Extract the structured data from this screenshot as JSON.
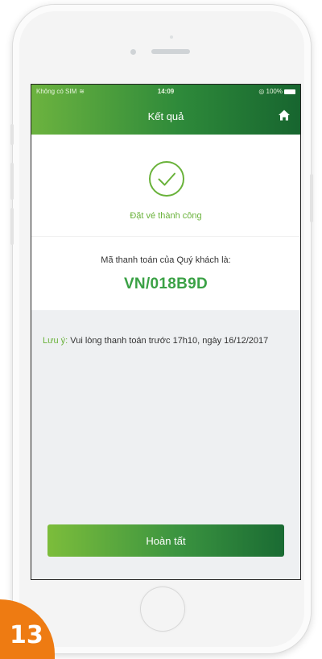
{
  "status_bar": {
    "carrier": "Không có SIM",
    "time": "14:09",
    "battery": "100%"
  },
  "header": {
    "title": "Kết quả",
    "home_icon": "home-icon"
  },
  "result": {
    "icon": "check-circle-icon",
    "success_text": "Đặt vé thành công",
    "code_label": "Mã thanh toán của Quý khách là:",
    "code_value": "VN/018B9D"
  },
  "note": {
    "label": "Lưu ý:",
    "text": " Vui lòng thanh toán trước 17h10, ngày 16/12/2017"
  },
  "actions": {
    "done_label": "Hoàn tất"
  },
  "step_badge": "13",
  "colors": {
    "accent_green": "#3aa145",
    "light_green": "#69b23a",
    "badge_orange": "#ee7b12"
  }
}
